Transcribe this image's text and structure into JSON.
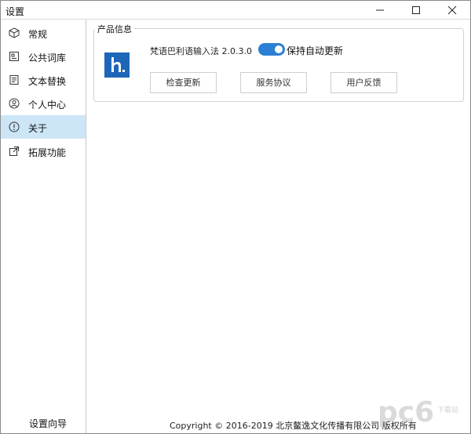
{
  "window": {
    "title": "设置"
  },
  "sidebar": {
    "items": [
      {
        "label": "常规",
        "icon": "cube-icon",
        "active": false
      },
      {
        "label": "公共词库",
        "icon": "dictionary-icon",
        "active": false
      },
      {
        "label": "文本替换",
        "icon": "document-icon",
        "active": false
      },
      {
        "label": "个人中心",
        "icon": "user-icon",
        "active": false
      },
      {
        "label": "关于",
        "icon": "info-icon",
        "active": true
      },
      {
        "label": "拓展功能",
        "icon": "external-link-icon",
        "active": false
      }
    ],
    "wizard_label": "设置向导"
  },
  "product_info": {
    "group_title": "产品信息",
    "logo_letter": "h.",
    "product_name": "梵语巴利语输入法 2.0.3.0",
    "auto_update_label": "保持自动更新",
    "auto_update_on": true,
    "buttons": {
      "check_update": "检查更新",
      "service_agreement": "服务协议",
      "user_feedback": "用户反馈"
    }
  },
  "footer": {
    "copyright": "Copyright © 2016-2019 北京鳌逸文化传播有限公司 版权所有"
  },
  "watermark": {
    "text": "pc6",
    "sub": "下载站"
  },
  "colors": {
    "accent": "#2b7fd4",
    "logo_bg": "#1d66b8",
    "active_nav": "#cde6f7"
  }
}
